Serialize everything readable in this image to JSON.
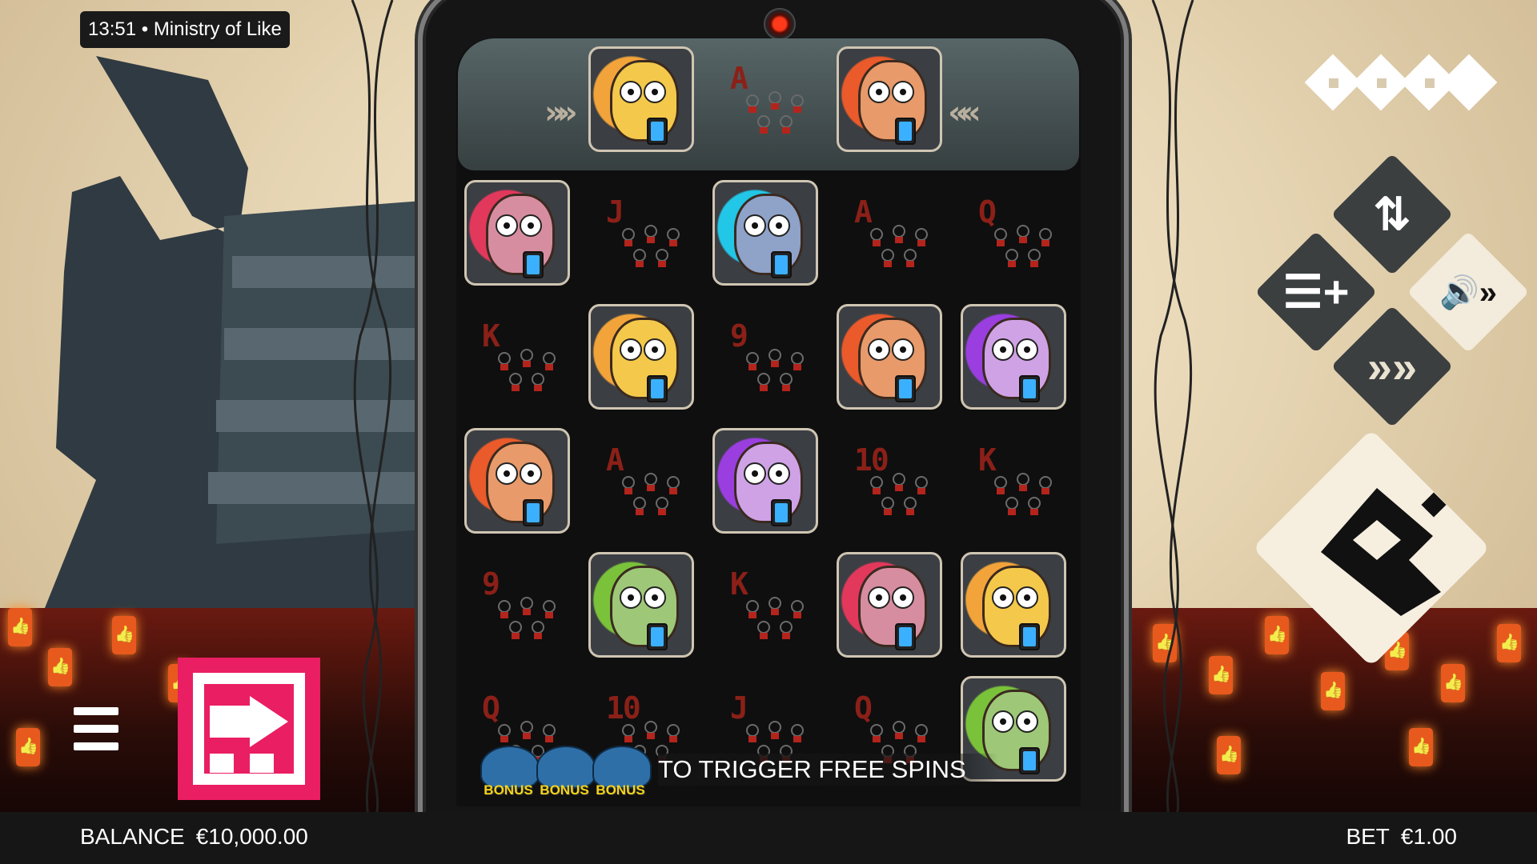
{
  "status": {
    "time": "13:51",
    "separator": "•",
    "game_title": "Ministry of Like"
  },
  "reels": {
    "grid": [
      [
        "",
        "char-yellow",
        "card-A",
        "char-orange",
        ""
      ],
      [
        "char-pink",
        "card-J",
        "char-cyan",
        "card-A",
        "card-Q"
      ],
      [
        "card-K",
        "char-yellow",
        "card-9",
        "char-orange",
        "char-purple"
      ],
      [
        "char-orange",
        "card-A",
        "char-purple",
        "card-10",
        "card-K"
      ],
      [
        "card-9",
        "char-green",
        "card-K",
        "char-pink",
        "char-yellow"
      ],
      [
        "card-Q",
        "card-10",
        "card-J",
        "card-Q",
        "char-green"
      ]
    ],
    "card_labels": {
      "A": "A",
      "J": "J",
      "Q": "Q",
      "K": "K",
      "9": "9",
      "10": "10"
    },
    "arrows_left": "»»",
    "arrows_right": "««"
  },
  "bonus": {
    "symbol_label": "BONUS",
    "message": "TO TRIGGER FREE SPINS"
  },
  "footer": {
    "balance_label": "BALANCE",
    "balance_value": "€10,000.00",
    "bet_label": "BET",
    "bet_value": "€1.00"
  },
  "controls": {
    "autoplay_icon": "swap-arrows-icon",
    "bet_settings_icon": "stack-plus-icon",
    "sound_icon": "speaker-fastforward-icon",
    "turbo_icon": "fast-forward-icon",
    "spin_icon": "spin-logo-icon",
    "menu_icon": "hamburger-menu-icon",
    "promo_icon": "pink-promo-icon"
  },
  "colors": {
    "accent_pink": "#ea1e63",
    "card_red": "#8b2018",
    "bonus_yellow": "#f4d31a"
  }
}
